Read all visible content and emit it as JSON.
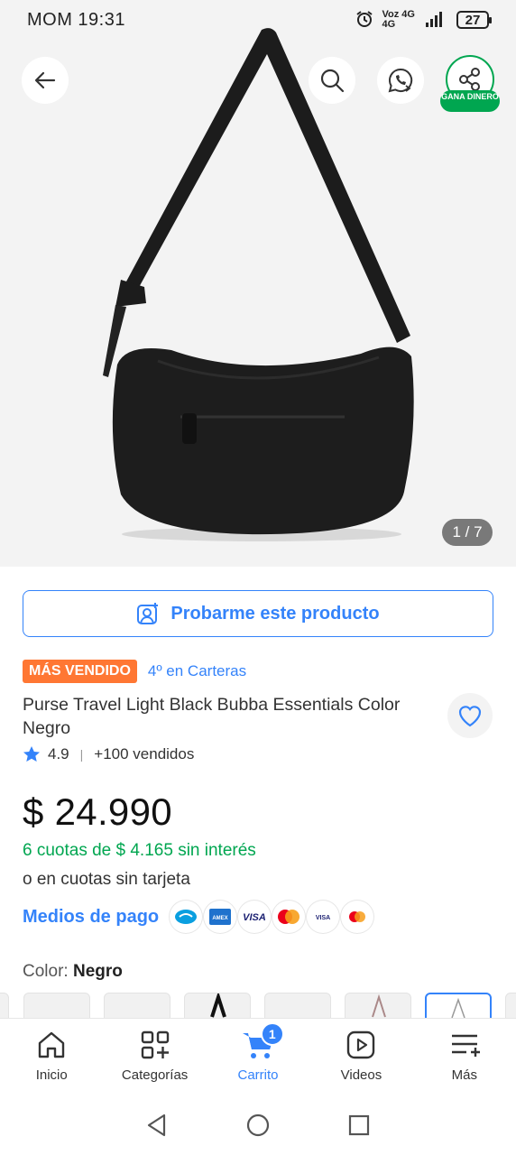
{
  "status_bar": {
    "carrier_time": "MOM 19:31",
    "network_top": "Voz 4G",
    "network_bottom": "4G",
    "battery": "27"
  },
  "gallery": {
    "counter": "1 / 7",
    "share_badge": "GANA DINERO"
  },
  "try_on": {
    "label": "Probarme este producto"
  },
  "badges": {
    "best_seller": "MÁS VENDIDO",
    "rank": "4º en Carteras"
  },
  "product": {
    "title": "Purse Travel Light Black Bubba Essentials Color Negro",
    "rating": "4.9",
    "sold": "+100 vendidos",
    "price": "$ 24.990",
    "installments": "6 cuotas de $ 4.165 sin interés",
    "installments_alt": "o en cuotas sin tarjeta",
    "payment_label": "Medios de pago",
    "payment_icons": [
      "mercadopago-icon",
      "amex-icon",
      "visa-icon",
      "mastercard-icon",
      "visa-debit-icon",
      "maestro-icon"
    ]
  },
  "color": {
    "label": "Color: ",
    "value": "Negro"
  },
  "bottom_nav": [
    {
      "label": "Inicio",
      "icon": "home-icon"
    },
    {
      "label": "Categorías",
      "icon": "categories-icon"
    },
    {
      "label": "Carrito",
      "icon": "cart-icon",
      "badge": "1"
    },
    {
      "label": "Videos",
      "icon": "video-icon"
    },
    {
      "label": "Más",
      "icon": "more-icon"
    }
  ],
  "colors": {
    "accent": "#3483fa",
    "green": "#00a650",
    "badge_orange": "#ff7733"
  }
}
